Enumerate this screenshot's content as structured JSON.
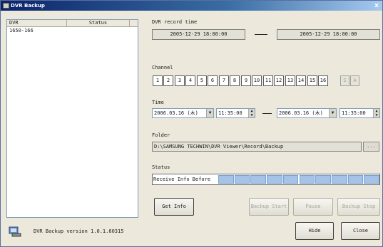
{
  "window": {
    "title": "DVR Backup",
    "close_glyph": "x"
  },
  "dvr_list": {
    "columns": [
      "DVR",
      "Status"
    ],
    "rows": [
      {
        "dvr": "1650-166",
        "status": ""
      }
    ]
  },
  "record_time": {
    "label": "DVR record time",
    "start": "2005-12-29 18:00:00",
    "end": "2005-12-29 18:00:00"
  },
  "channel": {
    "label": "Channel",
    "channels": [
      "1",
      "2",
      "3",
      "4",
      "5",
      "6",
      "7",
      "8",
      "9",
      "10",
      "11",
      "12",
      "13",
      "14",
      "15",
      "16"
    ],
    "extra_buttons": [
      "S",
      "A"
    ]
  },
  "time": {
    "label": "Time",
    "start_date": "2006.03.16 (木)",
    "start_time": "11:35:00",
    "end_date": "2006.03.16 (木)",
    "end_time": "11:35:00"
  },
  "folder": {
    "label": "Folder",
    "path": "D:\\SAMSUNG TECHWIN\\DVR Viewer\\Record\\Backup",
    "browse_label": "..."
  },
  "status": {
    "label": "Status",
    "text": "Receive Info Before",
    "progress_segments": 10
  },
  "buttons": {
    "get_info": "Get Info",
    "backup_start": "Backup Start",
    "pause": "Pause",
    "backup_stop": "Backup Stop",
    "hide": "Hide",
    "close": "Close"
  },
  "footer": {
    "version": "DVR Backup version 1.0.1.60315"
  },
  "icons": {
    "app": "dvr-backup-app-icon",
    "window": "window-icon",
    "close": "close-icon"
  },
  "colors": {
    "titlebar_start": "#0a246a",
    "progress_fill": "#a4c3e6"
  }
}
